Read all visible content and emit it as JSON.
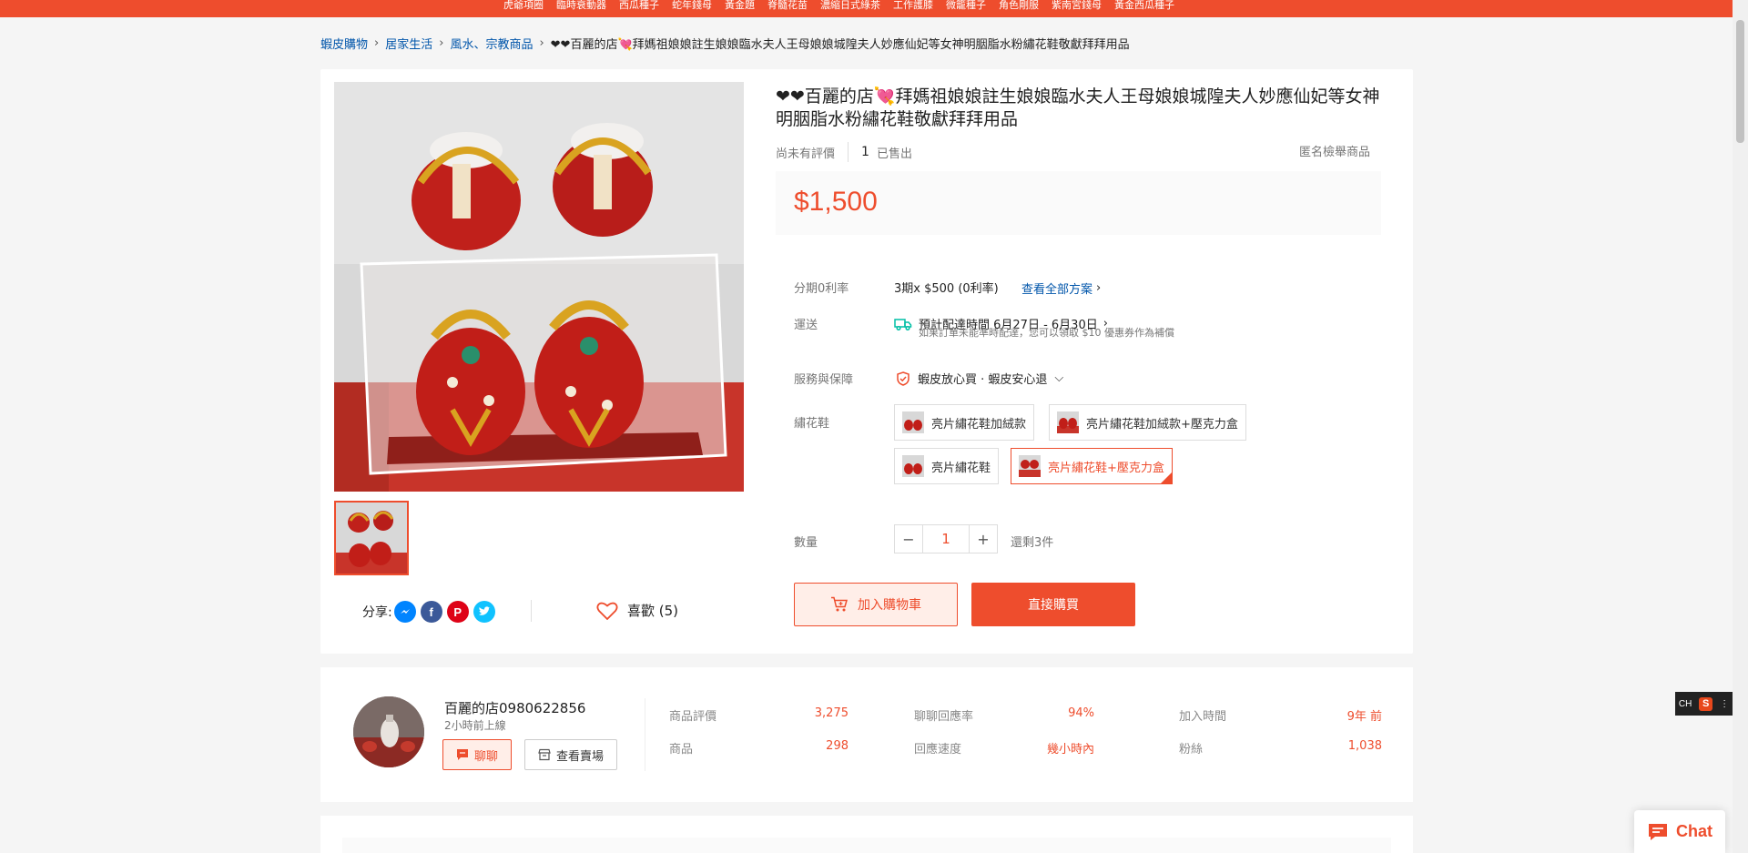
{
  "topbar": {
    "links": [
      "虎爺項圈",
      "臨時衰動器",
      "西瓜種子",
      "蛇年錢母",
      "黃金題",
      "脊髓花苗",
      "濃縮日式綠茶",
      "工作護膝",
      "微籠種子",
      "角色剛服",
      "紫南宮錢母",
      "黃金西瓜種子"
    ]
  },
  "breadcrumb": {
    "items": [
      "蝦皮購物",
      "居家生活",
      "風水、宗教商品"
    ],
    "current": "❤❤百麗的店💘拜媽祖娘娘註生娘娘臨水夫人王母娘娘城隍夫人妙應仙妃等女神明胭脂水粉繡花鞋敬獻拜拜用品"
  },
  "product": {
    "title": "❤❤百麗的店💘拜媽祖娘娘註生娘娘臨水夫人王母娘娘城隍夫人妙應仙妃等女神明胭脂水粉繡花鞋敬獻拜拜用品",
    "rating_text": "尚未有評價",
    "sold_count": "1",
    "sold_label": "已售出",
    "report": "匿名檢舉商品",
    "price": "$1,500",
    "installment_label": "分期0利率",
    "installment_value": "3期x $500 (0利率)",
    "installment_link": "查看全部方案",
    "shipping_label": "運送",
    "shipping_value": "預計配達時間 6月27日 - 6月30日",
    "shipping_note": "如果訂單未能準時配達，您可以領取 $10 優惠券作為補償",
    "guarantee_label": "服務與保障",
    "guarantee_value": "蝦皮放心買 · 蝦皮安心退",
    "variant_label": "繡花鞋",
    "variants": [
      "亮片繡花鞋加絨款",
      "亮片繡花鞋加絨款+壓克力盒",
      "亮片繡花鞋",
      "亮片繡花鞋+壓克力盒"
    ],
    "selected_variant": 3,
    "qty_label": "數量",
    "qty_minus": "−",
    "qty_value": "1",
    "qty_plus": "+",
    "stock": "還剩3件",
    "add_cart": "加入購物車",
    "buy_now": "直接購買",
    "share_label": "分享:",
    "like_label": "喜歡 (5)"
  },
  "shop": {
    "name": "百麗的店0980622856",
    "online": "2小時前上線",
    "chat_btn": "聊聊",
    "view_btn": "查看賣場",
    "stats": [
      {
        "label": "商品評價",
        "value": "3,275"
      },
      {
        "label": "聊聊回應率",
        "value": "94%"
      },
      {
        "label": "加入時間",
        "value": "9年 前"
      },
      {
        "label": "商品",
        "value": "298"
      },
      {
        "label": "回應速度",
        "value": "幾小時內"
      },
      {
        "label": "粉絲",
        "value": "1,038"
      }
    ]
  },
  "ime": {
    "lang": "CH",
    "logo": "S"
  },
  "chat_fab": "Chat",
  "colors": {
    "accent": "#ee4d2d",
    "link": "#0055aa"
  }
}
